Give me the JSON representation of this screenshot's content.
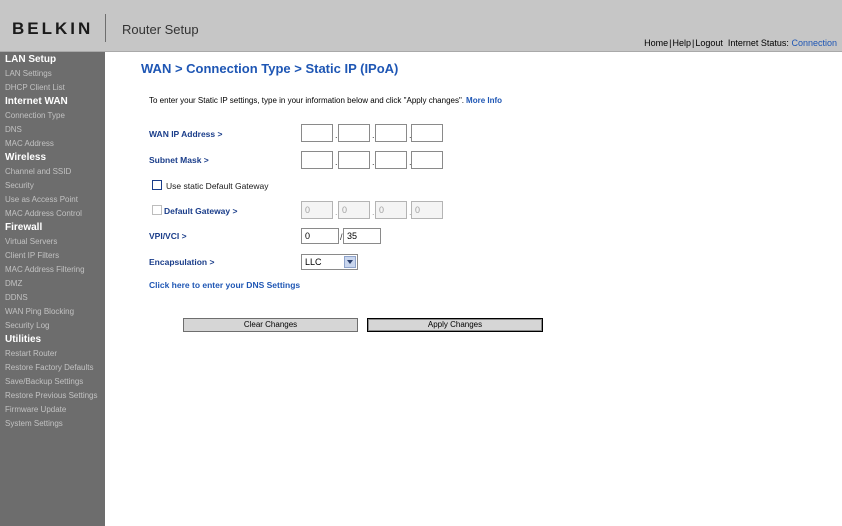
{
  "header": {
    "logo": "BELKIN",
    "title": "Router Setup",
    "links": {
      "home": "Home",
      "help": "Help",
      "logout": "Logout",
      "separator": "|"
    },
    "internet_status_label": "Internet Status:",
    "internet_status_value": "Connection"
  },
  "sidebar": {
    "sections": [
      {
        "title": "LAN Setup",
        "items": [
          "LAN Settings",
          "DHCP Client List"
        ]
      },
      {
        "title": "Internet WAN",
        "items": [
          "Connection Type",
          "DNS",
          "MAC Address"
        ]
      },
      {
        "title": "Wireless",
        "items": [
          "Channel and SSID",
          "Security",
          "Use as Access Point",
          "MAC Address Control"
        ]
      },
      {
        "title": "Firewall",
        "items": [
          "Virtual Servers",
          "Client IP Filters",
          "MAC Address Filtering",
          "DMZ",
          "DDNS",
          "WAN Ping Blocking",
          "Security Log"
        ]
      },
      {
        "title": "Utilities",
        "items": [
          "Restart Router",
          "Restore Factory Defaults",
          "Save/Backup Settings",
          "Restore Previous Settings",
          "Firmware Update",
          "System Settings"
        ]
      }
    ]
  },
  "main": {
    "title": "WAN > Connection Type > Static IP (IPoA)",
    "intro": "To enter your Static IP settings, type in your information below and click \"Apply changes\".",
    "more_info": "More Info",
    "wan_ip_label": "WAN IP Address >",
    "wan_ip": [
      "",
      "",
      "",
      ""
    ],
    "subnet_label": "Subnet Mask >",
    "subnet": [
      "",
      "",
      "",
      ""
    ],
    "ip_dot": ".",
    "use_gateway_label": "Use static Default Gateway",
    "gateway_label": "Default Gateway >",
    "gateway": [
      "0",
      "0",
      "0",
      "0"
    ],
    "vpi_label": "VPI/VCI >",
    "vpi": "0",
    "vci_slash": "/",
    "vci": "35",
    "encap_label": "Encapsulation >",
    "encap_value": "LLC",
    "dns_link": "Click here to enter your DNS Settings",
    "clear_button": "Clear Changes",
    "apply_button": "Apply Changes"
  },
  "colors": {
    "link_blue": "#1e56b4",
    "label_blue": "#1a3d8a",
    "sidebar_bg": "#6d6d6d",
    "header_bg": "#c6c6c6"
  }
}
